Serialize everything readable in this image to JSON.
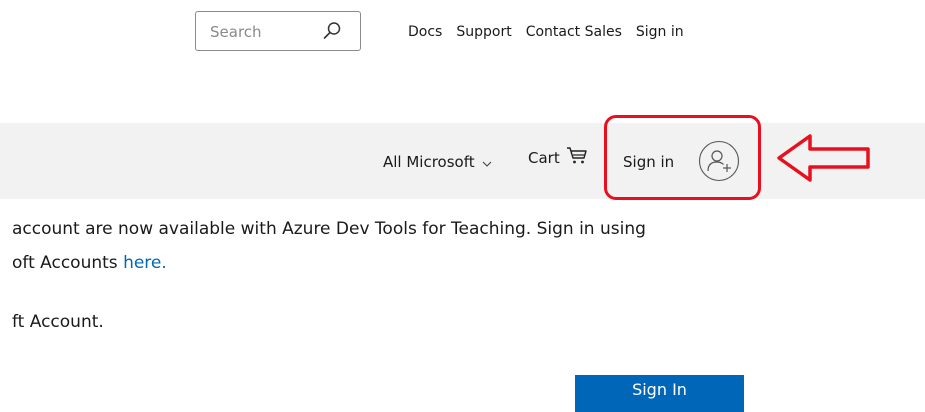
{
  "header": {
    "search": {
      "placeholder": "Search",
      "icon": "search-icon"
    },
    "links": [
      {
        "label": "Docs"
      },
      {
        "label": "Support"
      },
      {
        "label": "Contact Sales"
      },
      {
        "label": "Sign in"
      }
    ]
  },
  "nav": {
    "all_microsoft": "All Microsoft",
    "cart": "Cart",
    "sign_in": "Sign in",
    "avatar_icon": "person-add-icon"
  },
  "annotation": {
    "highlight_color": "#e8101f",
    "arrow_icon": "left-arrow-icon"
  },
  "content": {
    "line1": "account are now available with Azure Dev Tools for Teaching. Sign in using",
    "line2_prefix": "oft Accounts ",
    "line2_link": "here.",
    "line3": "ft Account.",
    "button_label": "Sign In"
  },
  "colors": {
    "accent": "#0067b8",
    "nav_background": "#f2f2f2",
    "annotation_red": "#e8101f"
  }
}
